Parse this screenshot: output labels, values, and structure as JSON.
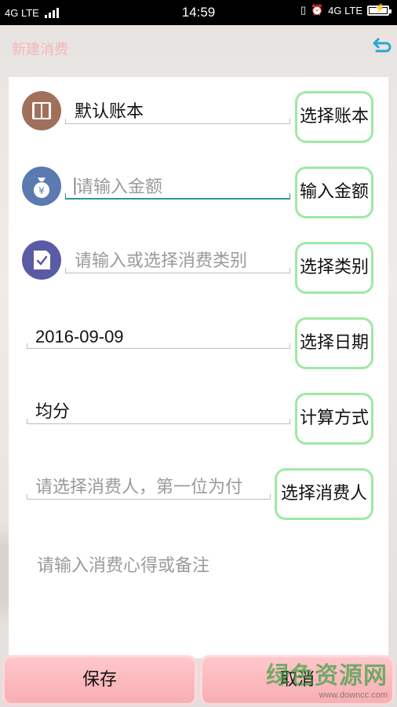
{
  "status_bar": {
    "left": "4G LTE",
    "time": "14:59",
    "right": "4G LTE"
  },
  "header": {
    "title": "新建消费",
    "back_icon": "back-arrow-icon"
  },
  "form": {
    "account": {
      "value": "默认账本",
      "button": "选择账本",
      "icon": "book-icon",
      "icon_color": "#a0705a"
    },
    "amount": {
      "placeholder": "请输入金额",
      "button": "输入金额",
      "icon": "money-bag-icon",
      "icon_color": "#5b7ab0"
    },
    "category": {
      "placeholder": "请输入或选择消费类别",
      "button": "选择类别",
      "icon": "checklist-icon",
      "icon_color": "#5b5aa6"
    },
    "date": {
      "value": "2016-09-09",
      "button": "选择日期"
    },
    "method": {
      "value": "均分",
      "button": "计算方式"
    },
    "payer": {
      "placeholder": "请选择消费人，第一位为付",
      "button": "选择消费人"
    },
    "note_placeholder": "请输入消费心得或备注"
  },
  "actions": {
    "save": "保存",
    "cancel": "取消"
  },
  "watermark": {
    "name": "绿色资源网",
    "url": "www.downcc.com"
  },
  "colors": {
    "button_border": "#9fe9a2",
    "header_title": "#f2b7bb",
    "back_icon": "#29a6d6",
    "focus_underline": "#2f96a0",
    "bottom_button": "#fbb7bb"
  }
}
